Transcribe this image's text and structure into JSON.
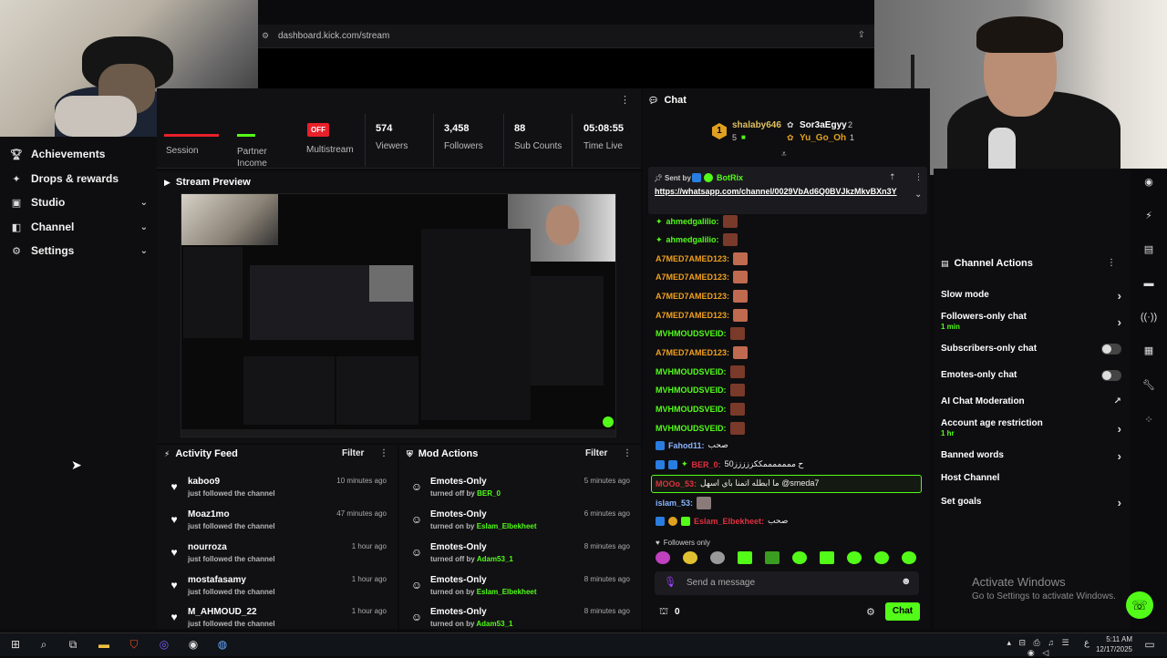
{
  "browser": {
    "url": "dashboard.kick.com/stream"
  },
  "sidebar": {
    "items": [
      {
        "label": "Achievements",
        "icon": "trophy-icon"
      },
      {
        "label": "Drops & rewards",
        "icon": "gift-icon"
      },
      {
        "label": "Studio",
        "icon": "studio-icon"
      },
      {
        "label": "Channel",
        "icon": "channel-icon"
      },
      {
        "label": "Settings",
        "icon": "gear-icon"
      }
    ]
  },
  "stats": {
    "session": "Session",
    "partner": "Partner Income",
    "multistream_badge": "OFF",
    "multistream": "Multistream",
    "viewers_value": "574",
    "viewers": "Viewers",
    "followers_value": "3,458",
    "followers": "Followers",
    "subs_value": "88",
    "subs": "Sub Counts",
    "time_value": "05:08:55",
    "time": "Time Live"
  },
  "preview": {
    "title": "Stream Preview"
  },
  "activity_feed": {
    "title": "Activity Feed",
    "filter": "Filter",
    "items": [
      {
        "name": "kaboo9",
        "sub": "just followed the channel",
        "time": "10 minutes ago"
      },
      {
        "name": "Moaz1mo",
        "sub": "just followed the channel",
        "time": "47 minutes ago"
      },
      {
        "name": "nourroza",
        "sub": "just followed the channel",
        "time": "1 hour ago"
      },
      {
        "name": "mostafasamy",
        "sub": "just followed the channel",
        "time": "1 hour ago"
      },
      {
        "name": "M_AHMOUD_22",
        "sub": "just followed the channel",
        "time": "1 hour ago"
      }
    ]
  },
  "mod_actions": {
    "title": "Mod Actions",
    "filter": "Filter",
    "items": [
      {
        "name": "Emotes-Only",
        "action": "turned off by",
        "user": "BER_0",
        "time": "5 minutes ago"
      },
      {
        "name": "Emotes-Only",
        "action": "turned on by",
        "user": "Eslam_Elbekheet",
        "time": "6 minutes ago"
      },
      {
        "name": "Emotes-Only",
        "action": "turned off by",
        "user": "Adam53_1",
        "time": "8 minutes ago"
      },
      {
        "name": "Emotes-Only",
        "action": "turned on by",
        "user": "Eslam_Elbekheet",
        "time": "8 minutes ago"
      },
      {
        "name": "Emotes-Only",
        "action": "turned on by",
        "user": "Adam53_1",
        "time": "8 minutes ago"
      }
    ]
  },
  "chat": {
    "title": "Chat",
    "gifters": [
      {
        "rank": "1",
        "name": "shalaby646",
        "count": "5"
      },
      {
        "rank": "",
        "name": "Sor3aEgyy",
        "count": "2"
      },
      {
        "rank": "",
        "name": "Yu_Go_Oh",
        "count": "1"
      }
    ],
    "pinned_by_label": "Sent by",
    "pinned_by": "BotRix",
    "pinned_link": "https://whatsapp.com/channel/0029VbAd6Q0BVJkzMkvBXn3Y",
    "messages": [
      {
        "user": "ahmedgalilio:",
        "text": "",
        "color": "#53fc18"
      },
      {
        "user": "ahmedgalilio:",
        "text": "",
        "color": "#53fc18"
      },
      {
        "user": "A7MED7AMED123:",
        "text": "",
        "color": "#f0a020"
      },
      {
        "user": "A7MED7AMED123:",
        "text": "",
        "color": "#f0a020"
      },
      {
        "user": "A7MED7AMED123:",
        "text": "",
        "color": "#f0a020"
      },
      {
        "user": "A7MED7AMED123:",
        "text": "",
        "color": "#f0a020"
      },
      {
        "user": "MVHMOUDSVEID:",
        "text": "",
        "color": "#53fc18"
      },
      {
        "user": "A7MED7AMED123:",
        "text": "",
        "color": "#f0a020"
      },
      {
        "user": "MVHMOUDSVEID:",
        "text": "",
        "color": "#53fc18"
      },
      {
        "user": "MVHMOUDSVEID:",
        "text": "",
        "color": "#53fc18"
      },
      {
        "user": "MVHMOUDSVEID:",
        "text": "",
        "color": "#53fc18"
      },
      {
        "user": "MVHMOUDSVEID:",
        "text": "",
        "color": "#53fc18"
      },
      {
        "user": "Fahod11:",
        "text": "صحب",
        "color": "#8ab4ff"
      },
      {
        "user": "BER_0:",
        "text": "ح مممممممككززززز50",
        "color": "#e03040"
      },
      {
        "user": "MOOo_53:",
        "text": "ما ابطله اتمنا باي اسهل @smeda7",
        "color": "#e03040"
      },
      {
        "user": "islam_53:",
        "text": "",
        "color": "#8ab4ff"
      },
      {
        "user": "Eslam_Elbekheet:",
        "text": "صحب",
        "color": "#e03040"
      }
    ],
    "followers_only": "Followers only",
    "placeholder": "Send a message",
    "count": "0",
    "send": "Chat"
  },
  "channel_actions": {
    "title": "Channel Actions",
    "items": [
      {
        "label": "Slow mode",
        "sub": "",
        "control": "arrow"
      },
      {
        "label": "Followers-only chat",
        "sub": "1 min",
        "control": "arrow"
      },
      {
        "label": "Subscribers-only chat",
        "sub": "",
        "control": "toggle"
      },
      {
        "label": "Emotes-only chat",
        "sub": "",
        "control": "toggle"
      },
      {
        "label": "AI Chat Moderation",
        "sub": "",
        "control": "external"
      },
      {
        "label": "Account age restriction",
        "sub": "1 hr",
        "control": "arrow"
      },
      {
        "label": "Banned words",
        "sub": "",
        "control": "arrow"
      },
      {
        "label": "Host Channel",
        "sub": "",
        "control": "none"
      },
      {
        "label": "Set goals",
        "sub": "",
        "control": "arrow"
      }
    ]
  },
  "windows": {
    "activate_title": "Activate Windows",
    "activate_sub": "Go to Settings to activate Windows.",
    "time": "5:11 AM",
    "date": "12/17/2025",
    "lang": "ع"
  },
  "colors": {
    "accent": "#53fc18",
    "bg": "#0e0e10",
    "off_badge": "#e8202a"
  }
}
